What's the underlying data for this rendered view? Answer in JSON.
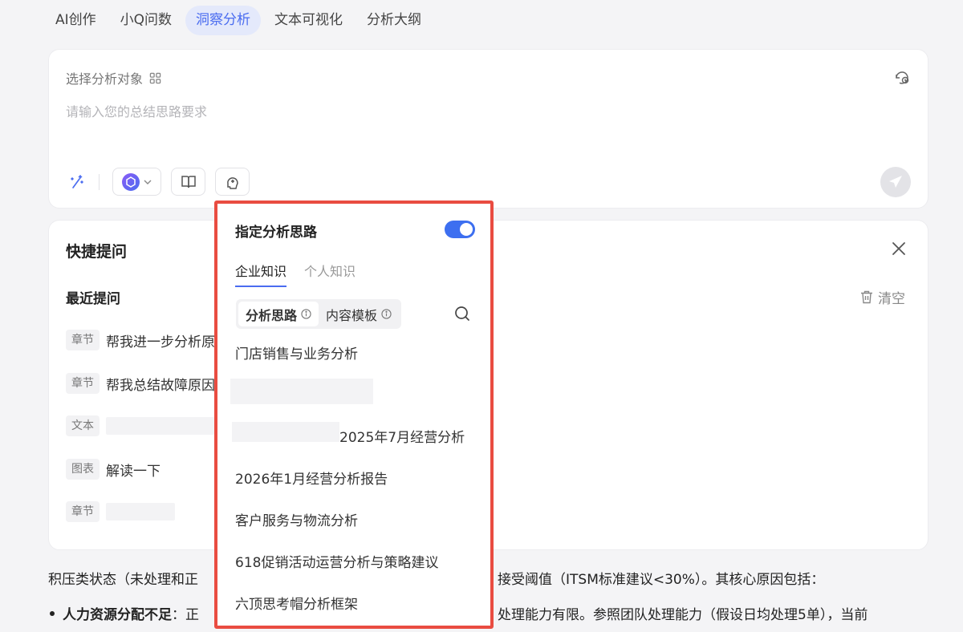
{
  "top_tabs": [
    "AI创作",
    "小Q问数",
    "洞察分析",
    "文本可视化",
    "分析大纲"
  ],
  "active_tab": "洞察分析",
  "input_card": {
    "select_target": "选择分析对象",
    "placeholder": "请输入您的总结思路要求"
  },
  "quick_ask": {
    "title": "快捷提问",
    "recent_title": "最近提问",
    "clear_label": "清空",
    "items": [
      {
        "tag": "章节",
        "text": "帮我进一步分析原"
      },
      {
        "tag": "章节",
        "text": "帮我总结故障原因"
      },
      {
        "tag": "文本",
        "text": ""
      },
      {
        "tag": "图表",
        "text": "解读一下"
      },
      {
        "tag": "章节",
        "text": ""
      }
    ]
  },
  "panel": {
    "title": "指定分析思路",
    "toggle_on": true,
    "tabs": [
      "企业知识",
      "个人知识"
    ],
    "segments": [
      "分析思路",
      "内容模板"
    ],
    "items": [
      "门店销售与业务分析",
      "",
      "2025年7月经营分析",
      "2026年1月经营分析报告",
      "客户服务与物流分析",
      "618促销活动运营分析与策略建议",
      "六顶思考帽分析框架"
    ]
  },
  "body": {
    "line1_left": "积压类状态（未处理和正",
    "line1_right": "接受阈值（ITSM标准建议<30%）。其核心原因包括：",
    "bullet_bold": "人力资源分配不足",
    "bullet_colon": "：正",
    "bullet_right": "处理能力有限。参照团队处理能力（假设日均处理5单），当前"
  },
  "colors": {
    "accent": "#4a6cf0",
    "toggle": "#3d6ff0",
    "highlight_border": "#e94c41"
  }
}
